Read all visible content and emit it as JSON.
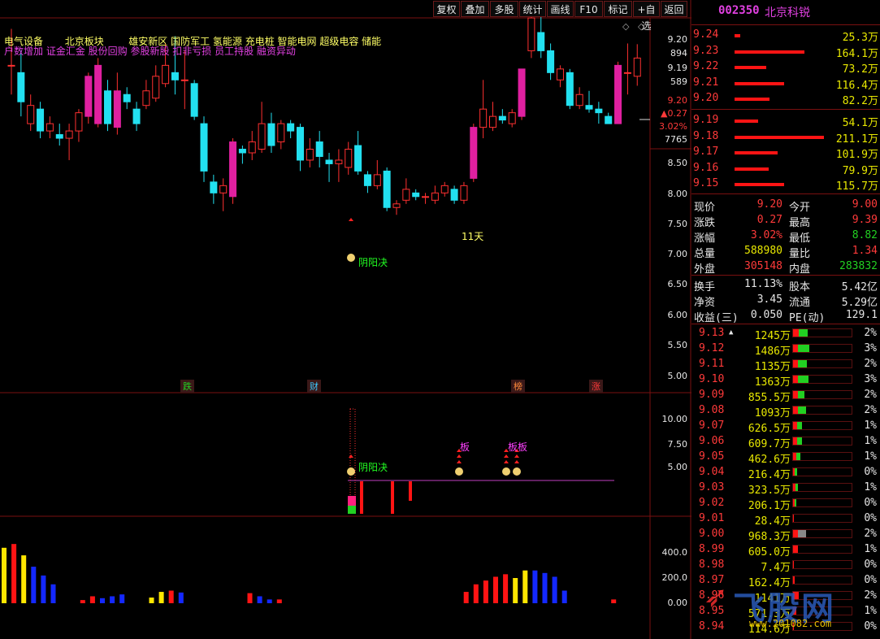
{
  "toolbar": {
    "buttons": [
      "复权",
      "叠加",
      "多股",
      "统计",
      "画线",
      "F10",
      "标记",
      "+自选",
      "返回"
    ]
  },
  "header": {
    "line1": "电气设备",
    "line1b": "北京板块",
    "line1c": "雄安新区 国防军工 氢能源 充电桩 智能电网 超级电容 储能",
    "line2": "户数增加 证金汇金 股份回购 参股新股 扣非亏损 员工持股 融资异动"
  },
  "price_axis": {
    "labels": [
      {
        "t": "9.20",
        "c": "#e6e6e6"
      },
      {
        "t": "894",
        "c": "#e6e6e6"
      },
      {
        "t": "9.19",
        "c": "#e6e6e6"
      },
      {
        "t": "589",
        "c": "#e6e6e6"
      },
      {
        "t": "9.20",
        "c": "#ff3a3a"
      },
      {
        "t": "▲0.27",
        "c": "#ff3a3a"
      },
      {
        "t": "3.02%",
        "c": "#ff3a3a"
      },
      {
        "t": "7765",
        "c": "#e6e6e6"
      },
      {
        "t": "8.50",
        "c": "#e6e6e6"
      },
      {
        "t": "8.00",
        "c": "#e6e6e6"
      },
      {
        "t": "7.50",
        "c": "#e6e6e6"
      },
      {
        "t": "7.00",
        "c": "#e6e6e6"
      },
      {
        "t": "6.50",
        "c": "#e6e6e6"
      },
      {
        "t": "6.00",
        "c": "#e6e6e6"
      },
      {
        "t": "5.50",
        "c": "#e6e6e6"
      },
      {
        "t": "5.00",
        "c": "#e6e6e6"
      }
    ],
    "mid_labels": [
      "10.00",
      "7.50",
      "5.00"
    ],
    "vol_labels": [
      "400.0",
      "200.0",
      "0.00"
    ]
  },
  "annotations": {
    "days": "11天",
    "yyj": "阴阳决",
    "yyj2": "阴阳决",
    "ban1": "板",
    "ban2": "板板",
    "markers": [
      {
        "t": "跌",
        "c": "#22d022"
      },
      {
        "t": "财",
        "c": "#3cc8ff"
      },
      {
        "t": "榜",
        "c": "#ff8a3a"
      },
      {
        "t": "涨",
        "c": "#ff3a3a"
      }
    ]
  },
  "stock": {
    "code": "002350",
    "name": "北京科锐"
  },
  "order_book": {
    "asks": [
      {
        "p": "9.24",
        "v": "25.3万",
        "w": 0.06
      },
      {
        "p": "9.23",
        "v": "164.1万",
        "w": 0.78
      },
      {
        "p": "9.22",
        "v": "73.2万",
        "w": 0.35
      },
      {
        "p": "9.21",
        "v": "116.4万",
        "w": 0.55
      },
      {
        "p": "9.20",
        "v": "82.2万",
        "w": 0.39
      }
    ],
    "bids": [
      {
        "p": "9.19",
        "v": "54.1万",
        "w": 0.26
      },
      {
        "p": "9.18",
        "v": "211.1万",
        "w": 1.0
      },
      {
        "p": "9.17",
        "v": "101.9万",
        "w": 0.48
      },
      {
        "p": "9.16",
        "v": "79.9万",
        "w": 0.38
      },
      {
        "p": "9.15",
        "v": "115.7万",
        "w": 0.55
      }
    ]
  },
  "stats": [
    [
      {
        "k": "现价",
        "v": "9.20",
        "vc": "red"
      },
      {
        "k": "今开",
        "v": "9.00",
        "vc": "red"
      }
    ],
    [
      {
        "k": "涨跌",
        "v": "0.27",
        "vc": "red"
      },
      {
        "k": "最高",
        "v": "9.39",
        "vc": "red"
      }
    ],
    [
      {
        "k": "涨幅",
        "v": "3.02%",
        "vc": "red"
      },
      {
        "k": "最低",
        "v": "8.82",
        "vc": "grn"
      }
    ],
    [
      {
        "k": "总量",
        "v": "588980",
        "vc": "yel"
      },
      {
        "k": "量比",
        "v": "1.34",
        "vc": "red"
      }
    ],
    [
      {
        "k": "外盘",
        "v": "305148",
        "vc": "red"
      },
      {
        "k": "内盘",
        "v": "283832",
        "vc": "grn"
      }
    ]
  ],
  "stats2": [
    [
      {
        "k": "换手",
        "v": "11.13%"
      },
      {
        "k": "股本",
        "v": "5.42亿"
      }
    ],
    [
      {
        "k": "净资",
        "v": "3.45"
      },
      {
        "k": "流通",
        "v": "5.29亿"
      }
    ],
    [
      {
        "k": "收益(三)",
        "v": "0.050"
      },
      {
        "k": "PE(动)",
        "v": "129.1"
      }
    ]
  ],
  "price_dist": [
    {
      "p": "9.13",
      "v": "1245万",
      "pct": "2%",
      "r": 0.35,
      "g": 0.4,
      "mark": true
    },
    {
      "p": "9.12",
      "v": "1486万",
      "pct": "3%",
      "r": 0.3,
      "g": 0.5
    },
    {
      "p": "9.11",
      "v": "1135万",
      "pct": "2%",
      "r": 0.3,
      "g": 0.38
    },
    {
      "p": "9.10",
      "v": "1363万",
      "pct": "3%",
      "r": 0.3,
      "g": 0.48
    },
    {
      "p": "9.09",
      "v": "855.5万",
      "pct": "2%",
      "r": 0.3,
      "g": 0.3
    },
    {
      "p": "9.08",
      "v": "1093万",
      "pct": "2%",
      "r": 0.3,
      "g": 0.36
    },
    {
      "p": "9.07",
      "v": "626.5万",
      "pct": "1%",
      "r": 0.25,
      "g": 0.2
    },
    {
      "p": "9.06",
      "v": "609.7万",
      "pct": "1%",
      "r": 0.25,
      "g": 0.2
    },
    {
      "p": "9.05",
      "v": "462.6万",
      "pct": "1%",
      "r": 0.22,
      "g": 0.15
    },
    {
      "p": "9.04",
      "v": "216.4万",
      "pct": "0%",
      "r": 0.12,
      "g": 0.08
    },
    {
      "p": "9.03",
      "v": "323.5万",
      "pct": "1%",
      "r": 0.15,
      "g": 0.1
    },
    {
      "p": "9.02",
      "v": "206.1万",
      "pct": "0%",
      "r": 0.12,
      "g": 0.05
    },
    {
      "p": "9.01",
      "v": "28.4万",
      "pct": "0%",
      "r": 0.03,
      "g": 0
    },
    {
      "p": "9.00",
      "v": "968.3万",
      "pct": "2%",
      "r": 0.3,
      "g": 0,
      "grey": 0.35
    },
    {
      "p": "8.99",
      "v": "605.0万",
      "pct": "1%",
      "r": 0.3,
      "g": 0
    },
    {
      "p": "8.98",
      "v": "7.4万",
      "pct": "0%",
      "r": 0.02,
      "g": 0
    },
    {
      "p": "8.97",
      "v": "162.4万",
      "pct": "0%",
      "r": 0.08,
      "g": 0
    },
    {
      "p": "8.96",
      "v": "1141万",
      "pct": "2%",
      "r": 0.35,
      "g": 0
    },
    {
      "p": "8.95",
      "v": "571.3万",
      "pct": "1%",
      "r": 0.2,
      "g": 0
    },
    {
      "p": "8.94",
      "v": "114.6万",
      "pct": "0%",
      "r": 0.06,
      "g": 0
    }
  ],
  "watermark": {
    "text": "飞股网",
    "url": "www.201082.com"
  },
  "chart_data": {
    "type": "candlestick",
    "ylim": [
      4.7,
      9.55
    ],
    "candles": [
      {
        "o": 9.1,
        "c": 9.1,
        "h": 9.6,
        "l": 8.7
      },
      {
        "o": 9.0,
        "c": 8.6,
        "h": 9.3,
        "l": 8.4
      },
      {
        "o": 8.3,
        "c": 8.55,
        "h": 8.7,
        "l": 8.2
      },
      {
        "o": 8.5,
        "c": 8.2,
        "h": 8.6,
        "l": 8.1
      },
      {
        "o": 8.2,
        "c": 8.3,
        "h": 8.4,
        "l": 8.1
      },
      {
        "o": 8.15,
        "c": 8.1,
        "h": 8.3,
        "l": 8.0
      },
      {
        "o": 8.1,
        "c": 8.2,
        "h": 8.3,
        "l": 7.8
      },
      {
        "o": 8.2,
        "c": 8.45,
        "h": 8.5,
        "l": 8.05
      },
      {
        "o": 8.4,
        "c": 8.95,
        "h": 9.0,
        "l": 8.3
      },
      {
        "o": 8.3,
        "c": 9.1,
        "h": 9.2,
        "l": 8.25
      },
      {
        "o": 8.75,
        "c": 8.3,
        "h": 8.9,
        "l": 8.2
      },
      {
        "o": 8.25,
        "c": 8.75,
        "h": 9.0,
        "l": 8.15
      },
      {
        "o": 8.7,
        "c": 8.6,
        "h": 8.8,
        "l": 8.5
      },
      {
        "o": 8.5,
        "c": 8.3,
        "h": 8.6,
        "l": 8.2
      },
      {
        "o": 8.55,
        "c": 8.75,
        "h": 8.9,
        "l": 8.5
      },
      {
        "o": 8.65,
        "c": 8.95,
        "h": 9.1,
        "l": 8.6
      },
      {
        "o": 8.85,
        "c": 9.1,
        "h": 9.4,
        "l": 8.8
      },
      {
        "o": 9.0,
        "c": 8.9,
        "h": 9.5,
        "l": 8.7
      },
      {
        "o": 8.9,
        "c": 8.9,
        "h": 9.3,
        "l": 8.5
      },
      {
        "o": 8.85,
        "c": 8.4,
        "h": 8.9,
        "l": 8.35
      },
      {
        "o": 8.3,
        "c": 7.65,
        "h": 8.4,
        "l": 7.5
      },
      {
        "o": 7.5,
        "c": 7.35,
        "h": 7.6,
        "l": 7.2
      },
      {
        "o": 7.35,
        "c": 7.45,
        "h": 7.55,
        "l": 7.1
      },
      {
        "o": 7.3,
        "c": 8.05,
        "h": 8.1,
        "l": 7.2
      },
      {
        "o": 7.95,
        "c": 7.9,
        "h": 8.0,
        "l": 7.75
      },
      {
        "o": 7.9,
        "c": 8.05,
        "h": 8.2,
        "l": 7.8
      },
      {
        "o": 7.95,
        "c": 8.3,
        "h": 8.6,
        "l": 7.9
      },
      {
        "o": 8.3,
        "c": 8.0,
        "h": 8.45,
        "l": 7.9
      },
      {
        "o": 8.05,
        "c": 8.3,
        "h": 8.35,
        "l": 7.95
      },
      {
        "o": 8.3,
        "c": 8.2,
        "h": 8.35,
        "l": 8.1
      },
      {
        "o": 8.25,
        "c": 7.8,
        "h": 8.3,
        "l": 7.65
      },
      {
        "o": 7.8,
        "c": 7.95,
        "h": 8.1,
        "l": 7.7
      },
      {
        "o": 8.05,
        "c": 7.85,
        "h": 8.2,
        "l": 7.7
      },
      {
        "o": 7.8,
        "c": 7.75,
        "h": 7.9,
        "l": 7.5
      },
      {
        "o": 7.75,
        "c": 7.8,
        "h": 7.95,
        "l": 7.5
      },
      {
        "o": 7.7,
        "c": 7.95,
        "h": 8.05,
        "l": 7.6
      },
      {
        "o": 8.0,
        "c": 7.65,
        "h": 8.2,
        "l": 7.6
      },
      {
        "o": 7.6,
        "c": 7.45,
        "h": 7.65,
        "l": 7.35
      },
      {
        "o": 7.45,
        "c": 7.6,
        "h": 7.8,
        "l": 7.4
      },
      {
        "o": 7.65,
        "c": 7.15,
        "h": 7.7,
        "l": 7.1
      },
      {
        "o": 7.15,
        "c": 7.2,
        "h": 7.25,
        "l": 7.05
      },
      {
        "o": 7.25,
        "c": 7.4,
        "h": 7.55,
        "l": 7.2
      },
      {
        "o": 7.35,
        "c": 7.3,
        "h": 7.4,
        "l": 7.25
      },
      {
        "o": 7.3,
        "c": 7.3,
        "h": 7.35,
        "l": 7.2
      },
      {
        "o": 7.25,
        "c": 7.35,
        "h": 7.45,
        "l": 7.2
      },
      {
        "o": 7.35,
        "c": 7.45,
        "h": 7.5,
        "l": 7.3
      },
      {
        "o": 7.4,
        "c": 7.25,
        "h": 7.45,
        "l": 7.2
      },
      {
        "o": 7.25,
        "c": 7.45,
        "h": 7.5,
        "l": 7.2
      },
      {
        "o": 7.55,
        "c": 8.25,
        "h": 8.3,
        "l": 7.5
      },
      {
        "o": 8.25,
        "c": 8.5,
        "h": 8.9,
        "l": 8.1
      },
      {
        "o": 8.25,
        "c": 8.4,
        "h": 8.6,
        "l": 8.2
      },
      {
        "o": 8.4,
        "c": 8.35,
        "h": 8.5,
        "l": 8.3
      },
      {
        "o": 8.3,
        "c": 8.45,
        "h": 8.5,
        "l": 8.25
      },
      {
        "o": 8.4,
        "c": 9.05,
        "h": 9.05,
        "l": 8.35
      },
      {
        "o": 9.3,
        "c": 9.75,
        "h": 9.8,
        "l": 9.2
      },
      {
        "o": 9.55,
        "c": 9.3,
        "h": 9.9,
        "l": 9.2
      },
      {
        "o": 9.3,
        "c": 9.0,
        "h": 9.4,
        "l": 8.9
      },
      {
        "o": 8.9,
        "c": 9.05,
        "h": 9.1,
        "l": 8.8
      },
      {
        "o": 9.0,
        "c": 8.55,
        "h": 9.05,
        "l": 8.5
      },
      {
        "o": 8.55,
        "c": 8.7,
        "h": 8.8,
        "l": 8.5
      },
      {
        "o": 8.55,
        "c": 8.5,
        "h": 8.75,
        "l": 8.45
      },
      {
        "o": 8.5,
        "c": 8.45,
        "h": 8.6,
        "l": 8.3
      },
      {
        "o": 8.4,
        "c": 8.3,
        "h": 8.45,
        "l": 8.3
      },
      {
        "o": 8.3,
        "c": 9.1,
        "h": 9.15,
        "l": 8.3
      },
      {
        "o": 9.0,
        "c": 9.0,
        "h": 9.4,
        "l": 8.7
      },
      {
        "o": 8.95,
        "c": 9.2,
        "h": 9.39,
        "l": 8.82
      }
    ],
    "volume": [
      {
        "v": 440,
        "c": "#ffe600"
      },
      {
        "v": 470,
        "c": "#ff1414"
      },
      {
        "v": 380,
        "c": "#ffe600"
      },
      {
        "v": 290,
        "c": "#1428ff"
      },
      {
        "v": 220,
        "c": "#1428ff"
      },
      {
        "v": 150,
        "c": "#1428ff"
      },
      {
        "v": 0,
        "c": "#000"
      },
      {
        "v": 0,
        "c": "#000"
      },
      {
        "v": 25,
        "c": "#ff1414"
      },
      {
        "v": 55,
        "c": "#ff1414"
      },
      {
        "v": 40,
        "c": "#1428ff"
      },
      {
        "v": 55,
        "c": "#1428ff"
      },
      {
        "v": 70,
        "c": "#1428ff"
      },
      {
        "v": 0,
        "c": "#000"
      },
      {
        "v": 0,
        "c": "#000"
      },
      {
        "v": 45,
        "c": "#ffe600"
      },
      {
        "v": 90,
        "c": "#ffe600"
      },
      {
        "v": 100,
        "c": "#ff1414"
      },
      {
        "v": 85,
        "c": "#1428ff"
      },
      {
        "v": 0,
        "c": "#000"
      },
      {
        "v": 0,
        "c": "#000"
      },
      {
        "v": 0,
        "c": "#000"
      },
      {
        "v": 0,
        "c": "#000"
      },
      {
        "v": 0,
        "c": "#000"
      },
      {
        "v": 0,
        "c": "#000"
      },
      {
        "v": 80,
        "c": "#ff1414"
      },
      {
        "v": 55,
        "c": "#1428ff"
      },
      {
        "v": 30,
        "c": "#1428ff"
      },
      {
        "v": 30,
        "c": "#ff1414"
      },
      {
        "v": 0,
        "c": "#000"
      },
      {
        "v": 0,
        "c": "#000"
      },
      {
        "v": 0,
        "c": "#000"
      },
      {
        "v": 0,
        "c": "#000"
      },
      {
        "v": 0,
        "c": "#000"
      },
      {
        "v": 0,
        "c": "#000"
      },
      {
        "v": 0,
        "c": "#000"
      },
      {
        "v": 0,
        "c": "#000"
      },
      {
        "v": 0,
        "c": "#000"
      },
      {
        "v": 0,
        "c": "#000"
      },
      {
        "v": 0,
        "c": "#000"
      },
      {
        "v": 0,
        "c": "#000"
      },
      {
        "v": 0,
        "c": "#000"
      },
      {
        "v": 0,
        "c": "#000"
      },
      {
        "v": 0,
        "c": "#000"
      },
      {
        "v": 0,
        "c": "#000"
      },
      {
        "v": 0,
        "c": "#000"
      },
      {
        "v": 0,
        "c": "#000"
      },
      {
        "v": 90,
        "c": "#ff1414"
      },
      {
        "v": 150,
        "c": "#ff1414"
      },
      {
        "v": 180,
        "c": "#ff1414"
      },
      {
        "v": 210,
        "c": "#ff1414"
      },
      {
        "v": 230,
        "c": "#ff1414"
      },
      {
        "v": 200,
        "c": "#ffe600"
      },
      {
        "v": 260,
        "c": "#ffe600"
      },
      {
        "v": 260,
        "c": "#1428ff"
      },
      {
        "v": 240,
        "c": "#1428ff"
      },
      {
        "v": 210,
        "c": "#1428ff"
      },
      {
        "v": 100,
        "c": "#1428ff"
      },
      {
        "v": 0,
        "c": "#000"
      },
      {
        "v": 0,
        "c": "#000"
      },
      {
        "v": 0,
        "c": "#000"
      },
      {
        "v": 0,
        "c": "#000"
      },
      {
        "v": 30,
        "c": "#ff1414"
      }
    ]
  }
}
